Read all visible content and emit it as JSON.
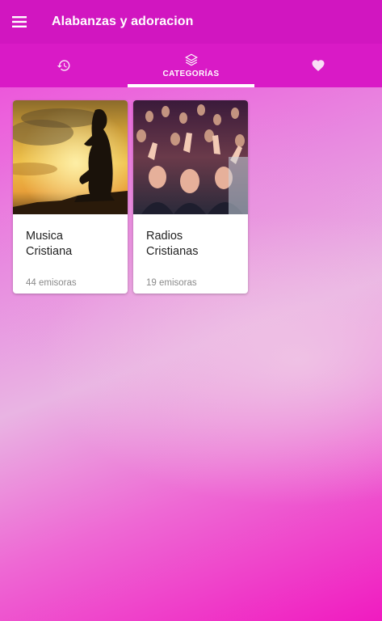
{
  "app": {
    "title": "Alabanzas y adoracion"
  },
  "tabs": [
    {
      "icon": "history-icon",
      "label": ""
    },
    {
      "icon": "layers-icon",
      "label": "CATEGORÍAS"
    },
    {
      "icon": "heart-icon",
      "label": ""
    }
  ],
  "categories": [
    {
      "title": "Musica\nCristiana",
      "count": "44 emisoras",
      "image": "praying-silhouette-sunset"
    },
    {
      "title": "Radios\nCristianas",
      "count": "19 emisoras",
      "image": "worship-crowd-hands-raised"
    }
  ],
  "colors": {
    "appbar": "#d116c0",
    "tabbar": "#d91ac6",
    "accent": "#ffffff"
  }
}
